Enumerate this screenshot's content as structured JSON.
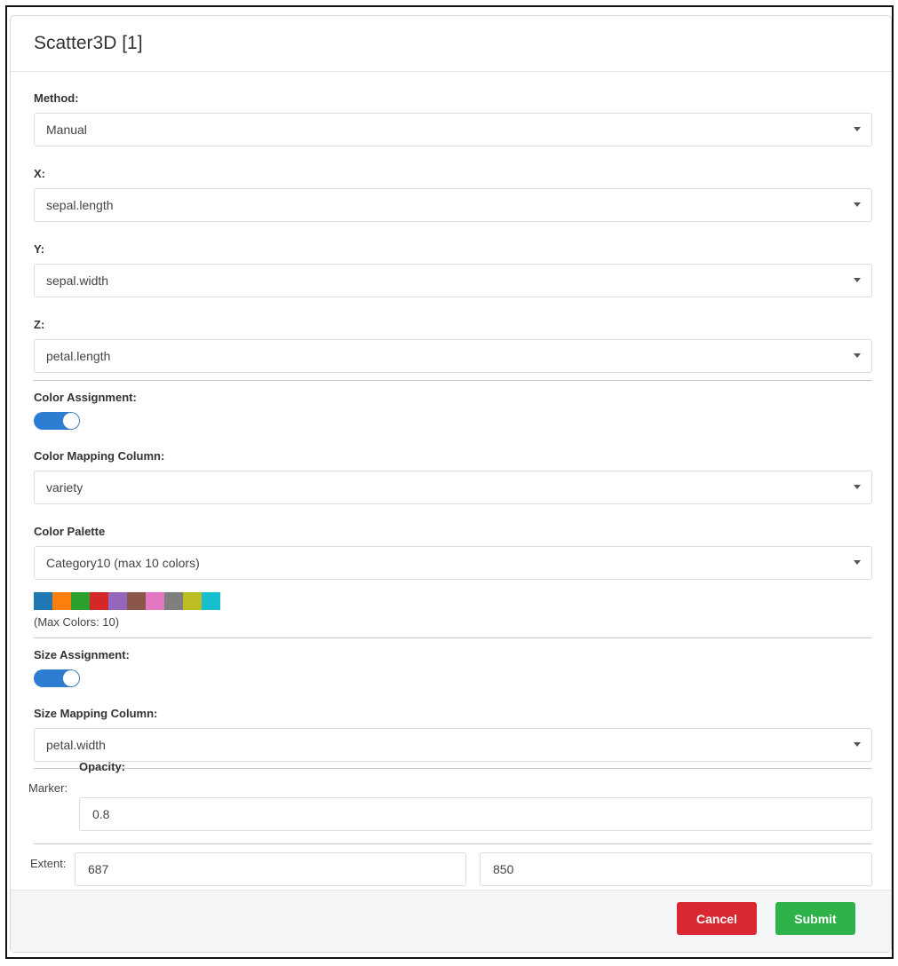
{
  "dialog": {
    "title": "Scatter3D [1]"
  },
  "method": {
    "label": "Method:",
    "value": "Manual"
  },
  "x": {
    "label": "X:",
    "value": "sepal.length"
  },
  "y": {
    "label": "Y:",
    "value": "sepal.width"
  },
  "z": {
    "label": "Z:",
    "value": "petal.length"
  },
  "color_assignment": {
    "label": "Color Assignment:",
    "enabled": true
  },
  "color_mapping": {
    "label": "Color Mapping Column:",
    "value": "variety"
  },
  "color_palette": {
    "label": "Color Palette",
    "value": "Category10 (max 10 colors)",
    "swatches": [
      "#1f77b4",
      "#ff7f0e",
      "#2ca02c",
      "#d62728",
      "#9467bd",
      "#8c564b",
      "#e377c2",
      "#7f7f7f",
      "#bcbd22",
      "#17becf"
    ],
    "max_colors_text": "(Max Colors: 10)"
  },
  "size_assignment": {
    "label": "Size Assignment:",
    "enabled": true
  },
  "size_mapping": {
    "label": "Size Mapping Column:",
    "value": "petal.width"
  },
  "marker": {
    "label": "Marker:",
    "opacity_label": "Opacity:",
    "opacity_value": "0.8"
  },
  "extent": {
    "label": "Extent:",
    "width": "687",
    "height": "850"
  },
  "footer": {
    "cancel": "Cancel",
    "submit": "Submit"
  },
  "colors": {
    "toggle_on": "#2d7dd2",
    "cancel": "#d9282f",
    "submit": "#2eb24a"
  }
}
